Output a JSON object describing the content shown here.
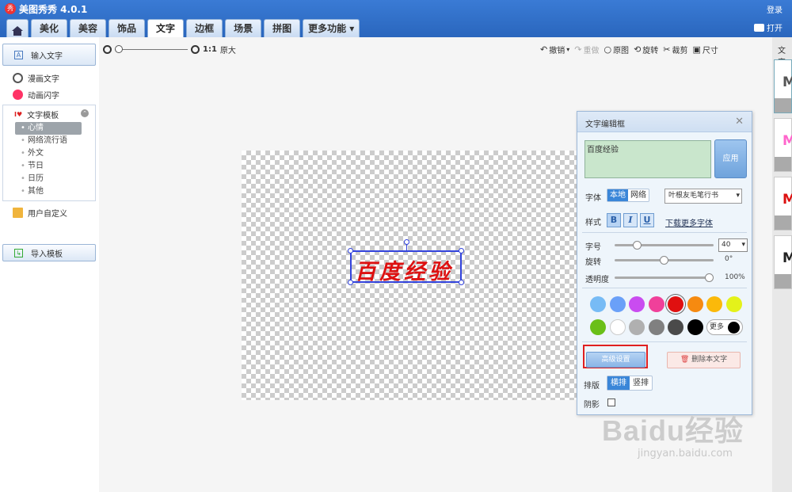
{
  "app": {
    "title": "美图秀秀 4.0.1",
    "login": "登录",
    "open": "打开"
  },
  "tabs": [
    {
      "label": "美化"
    },
    {
      "label": "美容"
    },
    {
      "label": "饰品"
    },
    {
      "label": "文字"
    },
    {
      "label": "边框"
    },
    {
      "label": "场景"
    },
    {
      "label": "拼图"
    },
    {
      "label": "更多功能"
    }
  ],
  "sidebar": {
    "input_text": "输入文字",
    "comic_text": "漫画文字",
    "anim_text": "动画闪字",
    "templates_title": "文字模板",
    "template_items": [
      {
        "label": "心情"
      },
      {
        "label": "网络流行语"
      },
      {
        "label": "外文"
      },
      {
        "label": "节日"
      },
      {
        "label": "日历"
      },
      {
        "label": "其他"
      }
    ],
    "user_custom": "用户自定义",
    "import_template": "导入模板"
  },
  "zoom": {
    "ratio": "1:1",
    "original": "原大"
  },
  "tools": {
    "undo": "撤销",
    "redo": "重做",
    "original": "原图",
    "rotate": "旋转",
    "crop": "裁剪",
    "size": "尺寸"
  },
  "canvas_text": "百度经验",
  "right_panel": {
    "label": "文字",
    "thumbs": [
      {
        "letter": "M"
      },
      {
        "letter": "M"
      },
      {
        "letter": "M"
      },
      {
        "letter": "M"
      }
    ]
  },
  "dialog": {
    "title": "文字编辑框",
    "text_value": "百度经验",
    "apply": "应用",
    "font_label": "字体",
    "font_local": "本地",
    "font_net": "网络",
    "font_value": "叶根友毛笔行书",
    "style_label": "样式",
    "style_bold": "B",
    "style_italic": "I",
    "style_underline": "U",
    "download_fonts": "下载更多字体",
    "size_label": "字号",
    "size_value": "40",
    "size_level": 0.2,
    "rotate_label": "旋转",
    "rotate_value": "0°",
    "rotate_level": 0.5,
    "opacity_label": "透明度",
    "opacity_value": "100%",
    "opacity_level": 1.0,
    "colors": [
      "#77bbf5",
      "#6aa0f8",
      "#c94cf0",
      "#f0409a",
      "#e01010",
      "#f68a10",
      "#fbb90a",
      "#e4f21a",
      "#6abf18",
      "#ffffff",
      "#b0b0b0",
      "#808080",
      "#4a4a4a",
      "#000000"
    ],
    "selected_color": "#e01010",
    "more_colors": "更多",
    "advanced": "高级设置",
    "delete_text": "删除本文字",
    "layout_label": "排版",
    "layout_horizontal": "横排",
    "layout_vertical": "竖排",
    "shadow_label": "阴影"
  },
  "watermark": {
    "main": "Baidu经验",
    "sub": "jingyan.baidu.com"
  }
}
